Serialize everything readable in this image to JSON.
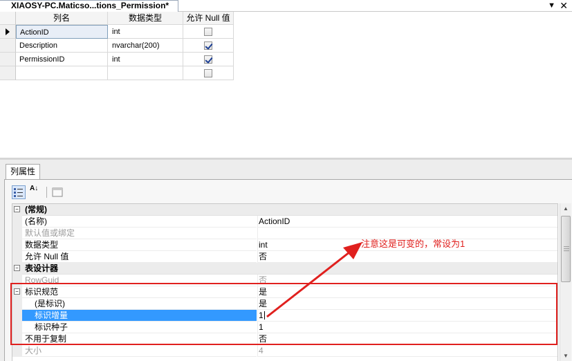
{
  "tab": {
    "title": "XIAOSY-PC.Maticso...tions_Permission*",
    "menu_glyph": "▼",
    "close_glyph": "✕"
  },
  "grid": {
    "headers": {
      "name": "列名",
      "type": "数据类型",
      "allow_null": "允许 Null 值"
    },
    "rows": [
      {
        "name": "ActionID",
        "type": "int",
        "allow_null": false,
        "selected": true
      },
      {
        "name": "Description",
        "type": "nvarchar(200)",
        "allow_null": true
      },
      {
        "name": "PermissionID",
        "type": "int",
        "allow_null": true
      },
      {
        "name": "",
        "type": "",
        "allow_null": false
      }
    ]
  },
  "panel": {
    "tab_label": "列属性",
    "toolbar": {
      "categorized_icon": "categorized-icon",
      "alpha_sort_label": "A↓",
      "property_pages_icon": "property-pages-icon"
    },
    "categories": {
      "general": {
        "expander": "−",
        "label": "(常规)"
      },
      "table_designer": {
        "expander": "−",
        "label": "表设计器"
      },
      "identity": {
        "expander": "−"
      }
    },
    "properties": {
      "name": {
        "label": "(名称)",
        "value": "ActionID"
      },
      "default": {
        "label": "默认值或绑定",
        "value": ""
      },
      "data_type": {
        "label": "数据类型",
        "value": "int"
      },
      "allow_null": {
        "label": "允许 Null 值",
        "value": "否"
      },
      "rowguid": {
        "label": "RowGuid",
        "value": "否"
      },
      "identity_spec": {
        "label": "标识规范",
        "value": "是"
      },
      "is_identity": {
        "label": "(是标识)",
        "value": "是"
      },
      "increment": {
        "label": "标识增量",
        "value": "1"
      },
      "seed": {
        "label": "标识种子",
        "value": "1"
      },
      "not_for_repl": {
        "label": "不用于复制",
        "value": "否"
      },
      "size": {
        "label": "大小",
        "value": "4"
      }
    }
  },
  "annotation": {
    "text": "注意这是可变的，常设为1",
    "color": "#e0201e"
  }
}
